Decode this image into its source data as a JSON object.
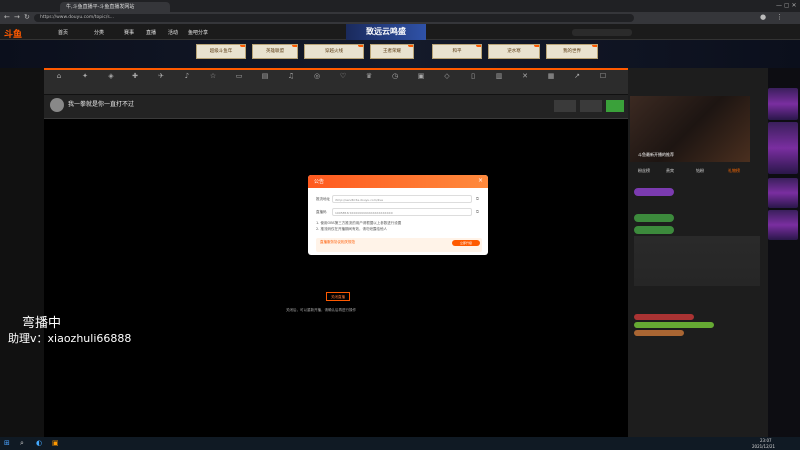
{
  "browser": {
    "tab_title": "牛,斗鱼直播平-斗鱼直播发网站",
    "url": "https://www.douyu.com/topic/s..."
  },
  "site": {
    "logo": "斗鱼",
    "nav": [
      "首页",
      "分类",
      "赛事",
      "直播",
      "活动",
      "鱼吧分享"
    ],
    "banner_text": "致远云鸣盛",
    "banner_buttons": [
      "超级斗鱼年",
      "英雄联盟",
      "穿越火线",
      "王者荣耀",
      "和平",
      "逆水寒",
      "我的世界"
    ]
  },
  "room": {
    "title": "我一拳就是你一直打不过"
  },
  "modal": {
    "title": "公告",
    "row1_label": "推流地址",
    "row1_value": "rtmp://sendtc3a.douyu.com/live",
    "row2_label": "直播码",
    "row2_value": "1005853rXXXXXXXXXXXXXXXXXXXXX",
    "note1": "1. 使用OBS第三方推流的用户请根据以上参数进行设置",
    "note2": "2. 推流码仅在开播期间有效，请勿泄露给他人",
    "tip_title": "直播服务协议相关规范",
    "tip_button": "立即升级"
  },
  "player": {
    "open_button": "关闭直播",
    "hint": "关闭后，可以重新开播，请确认后再进行操作"
  },
  "right_panel": {
    "tabs": [
      "粉丝榜",
      "贵宾",
      "钻粉",
      "礼物榜"
    ],
    "preview_caption": "斗鱼最新开播的推荐"
  },
  "watermark": {
    "line1": "弯播中",
    "line2": "助理v：xiaozhuli66888"
  },
  "taskbar": {
    "time": "23:07",
    "date": "2021/12/21"
  }
}
